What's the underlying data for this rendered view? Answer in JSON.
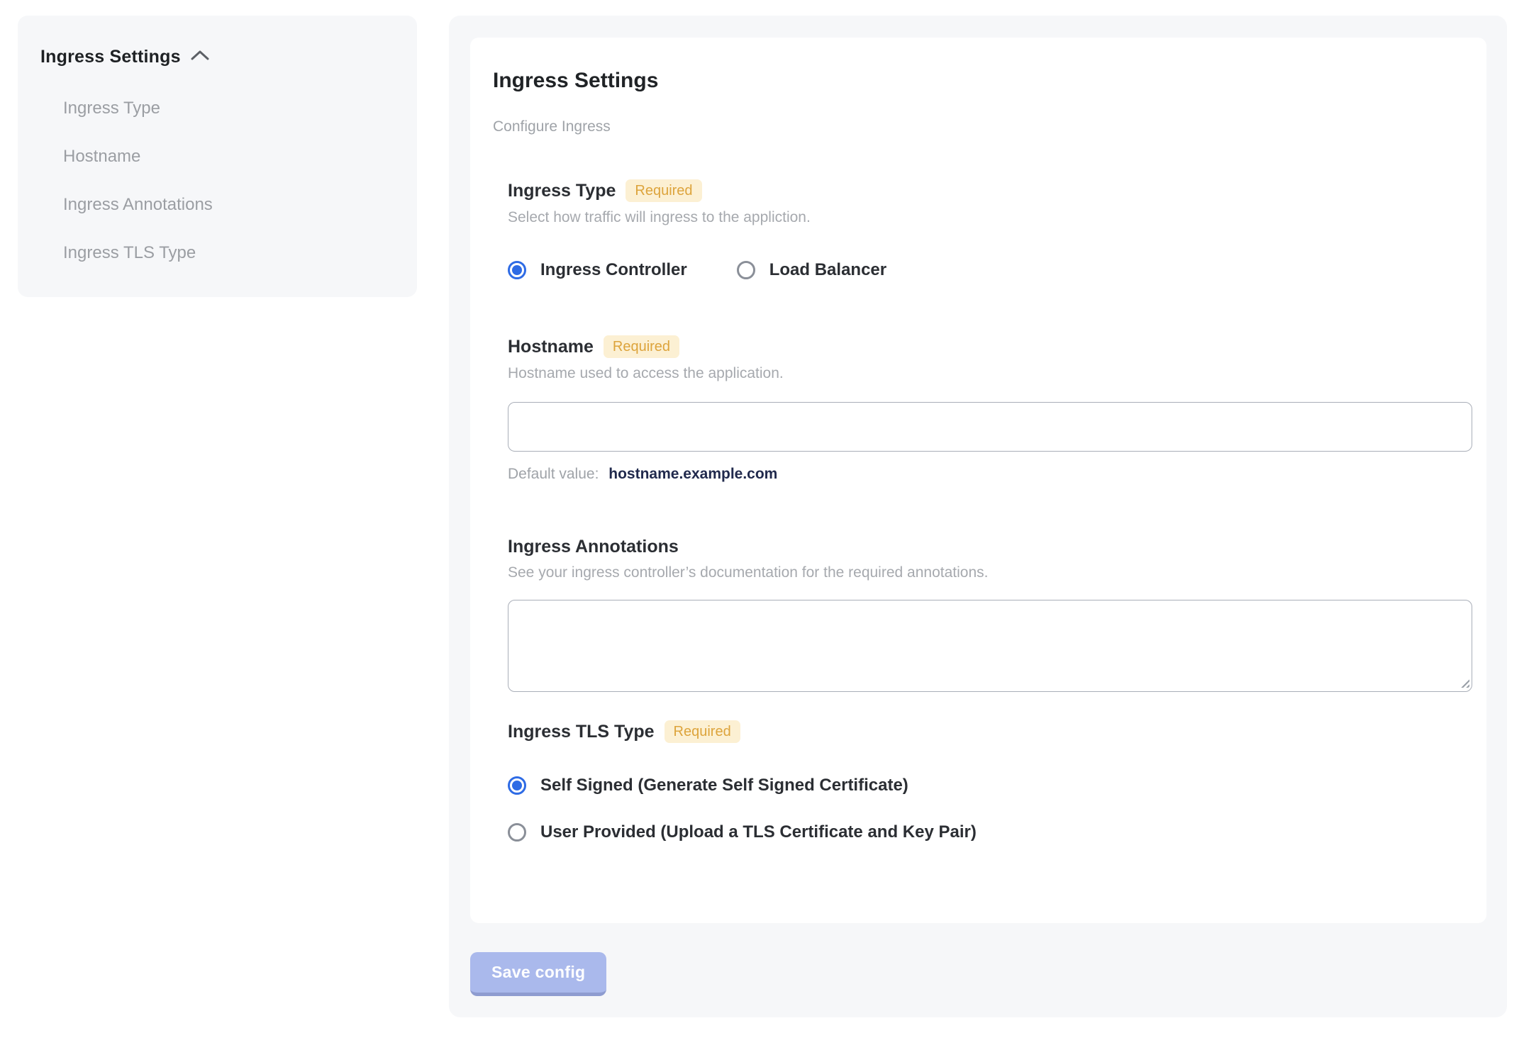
{
  "colors": {
    "accent_blue": "#2e6be5",
    "badge_bg": "#fcf0d3",
    "badge_text": "#dda43c",
    "save_bg": "#aab9ec",
    "save_edge": "#8e9cd0",
    "panel_bg": "#f6f7f9"
  },
  "sidebar": {
    "title": "Ingress Settings",
    "collapse_icon": "chevron-up",
    "items": [
      {
        "label": "Ingress Type"
      },
      {
        "label": "Hostname"
      },
      {
        "label": "Ingress Annotations"
      },
      {
        "label": "Ingress TLS Type"
      }
    ]
  },
  "panel": {
    "title": "Ingress Settings",
    "subtitle": "Configure Ingress",
    "required_label": "Required",
    "sections": {
      "ingress_type": {
        "label": "Ingress Type",
        "required": true,
        "help": "Select how traffic will ingress to the appliction.",
        "options": [
          {
            "label": "Ingress Controller",
            "selected": true
          },
          {
            "label": "Load Balancer",
            "selected": false
          }
        ]
      },
      "hostname": {
        "label": "Hostname",
        "required": true,
        "help": "Hostname used to access the application.",
        "value": "",
        "default_prefix": "Default value:",
        "default_value": "hostname.example.com"
      },
      "annotations": {
        "label": "Ingress Annotations",
        "help": "See your ingress controller’s documentation for the required annotations.",
        "value": ""
      },
      "tls_type": {
        "label": "Ingress TLS Type",
        "required": true,
        "options": [
          {
            "label": "Self Signed (Generate Self Signed Certificate)",
            "selected": true
          },
          {
            "label": "User Provided (Upload a TLS Certificate and Key Pair)",
            "selected": false
          }
        ]
      }
    },
    "save_button": "Save config"
  }
}
